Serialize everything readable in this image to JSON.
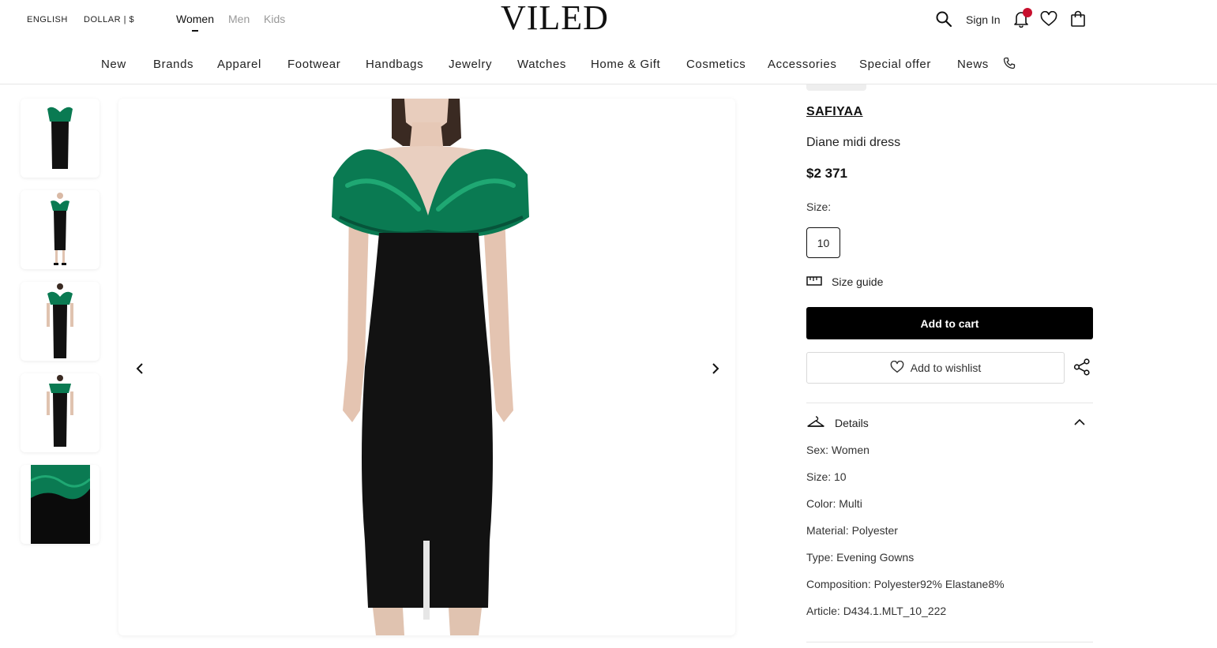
{
  "header": {
    "language": "ENGLISH",
    "currency": "DOLLAR | $",
    "genders": [
      "Women",
      "Men",
      "Kids"
    ],
    "active_gender": "Women",
    "logo": "VILED",
    "sign_in": "Sign In",
    "icons": [
      "search-icon",
      "bell-icon",
      "heart-icon",
      "bag-icon"
    ],
    "notification_color": "#c8102e"
  },
  "nav": {
    "items": [
      "New",
      "Brands",
      "Apparel",
      "Footwear",
      "Handbags",
      "Jewelry",
      "Watches",
      "Home & Gift",
      "Cosmetics",
      "Accessories",
      "Special offer",
      "News"
    ],
    "phone_icon": "phone-icon"
  },
  "gallery": {
    "thumbnail_count": 5,
    "prev_icon": "chevron-left-icon",
    "next_icon": "chevron-right-icon",
    "dress_colors": {
      "bodice": "#0a7a52",
      "body": "#111111"
    }
  },
  "product": {
    "brand": "SAFIYAA",
    "name": "Diane midi dress",
    "price": "$2 371",
    "size_label": "Size:",
    "sizes": [
      "10"
    ],
    "size_guide": "Size guide",
    "add_to_cart": "Add to cart",
    "add_to_wishlist": "Add to wishlist",
    "details_title": "Details",
    "details": [
      {
        "label": "Sex:",
        "value": "Women"
      },
      {
        "label": "Size:",
        "value": "10"
      },
      {
        "label": "Color:",
        "value": "Multi"
      },
      {
        "label": "Material:",
        "value": "Polyester"
      },
      {
        "label": "Type:",
        "value": "Evening Gowns"
      },
      {
        "label": "Composition:",
        "value": "Polyester92% Elastane8%"
      },
      {
        "label": "Article:",
        "value": "D434.1.MLT_10_222"
      }
    ]
  }
}
